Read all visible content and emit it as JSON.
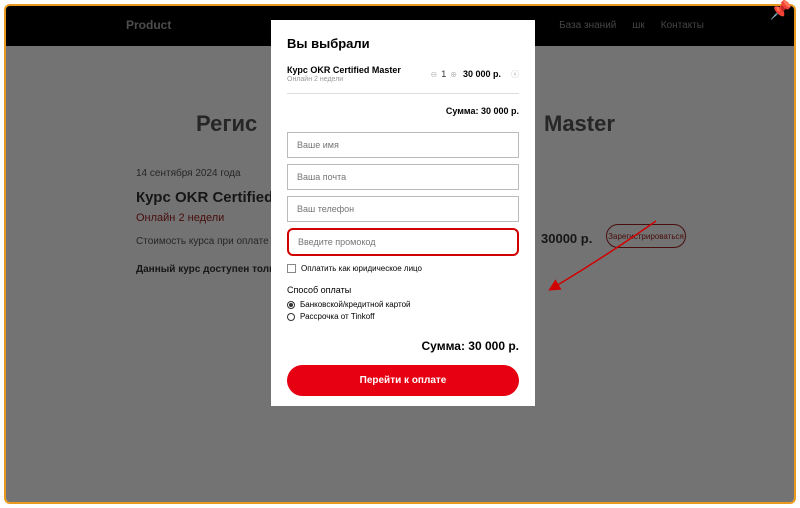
{
  "header": {
    "logo": "Product",
    "nav": [
      "",
      "",
      "",
      "",
      "База знаний",
      "шк",
      "Контакты"
    ]
  },
  "background": {
    "title_left": "Регис",
    "title_right": "Master",
    "date": "14 сентября 2024 года",
    "course_title": "Курс OKR Certified Ma",
    "sub": "Онлайн 2 недели",
    "desc1": "Стоимость курса при оплате не позднее",
    "desc2": "Данный курс доступен только для уч",
    "price": "30000 р.",
    "register_btn": "Зарегистрироваться"
  },
  "modal": {
    "title": "Вы выбрали",
    "product_name": "Курс OKR Certified Master",
    "product_sub": "Онлайн 2 недели",
    "qty": "1",
    "product_price": "30 000 р.",
    "sum_label": "Сумма: 30 000 р.",
    "fields": {
      "name_ph": "Ваше имя",
      "email_ph": "Ваша почта",
      "phone_ph": "Ваш телефон",
      "promo_ph": "Введите промокод"
    },
    "legal_check": "Оплатить как юридическое лицо",
    "pay_method_label": "Способ оплаты",
    "pay_options": [
      "Банковской/кредитной картой",
      "Рассрочка от Tinkoff"
    ],
    "sum_big": "Сумма: 30 000 р.",
    "pay_button": "Перейти к оплате"
  },
  "colors": {
    "frame": "#e89a1f",
    "accent": "#e60012",
    "promo_border": "#d10000"
  }
}
